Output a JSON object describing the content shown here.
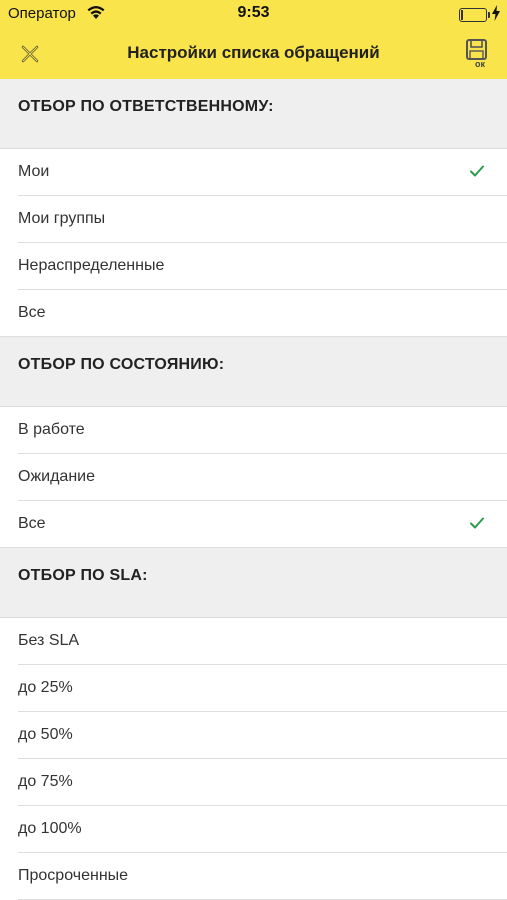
{
  "status_bar": {
    "carrier": "Оператор",
    "time": "9:53"
  },
  "nav": {
    "title": "Настройки списка обращений",
    "close_icon": "close-icon",
    "ok_icon": "save-ok-icon"
  },
  "sections": [
    {
      "header": "ОТБОР ПО ОТВЕТСТВЕННОМУ:",
      "items": [
        {
          "label": "Мои",
          "selected": true
        },
        {
          "label": "Мои группы",
          "selected": false
        },
        {
          "label": "Нераспределенные",
          "selected": false
        },
        {
          "label": "Все",
          "selected": false
        }
      ]
    },
    {
      "header": "ОТБОР ПО СОСТОЯНИЮ:",
      "items": [
        {
          "label": "В работе",
          "selected": false
        },
        {
          "label": "Ожидание",
          "selected": false
        },
        {
          "label": "Все",
          "selected": true
        }
      ]
    },
    {
      "header": "ОТБОР ПО SLA:",
      "items": [
        {
          "label": "Без SLA",
          "selected": false
        },
        {
          "label": "до 25%",
          "selected": false
        },
        {
          "label": "до 50%",
          "selected": false
        },
        {
          "label": "до 75%",
          "selected": false
        },
        {
          "label": "до 100%",
          "selected": false
        },
        {
          "label": "Просроченные",
          "selected": false
        }
      ]
    }
  ],
  "colors": {
    "accent": "#f9e44c",
    "check": "#2e9b4a",
    "section_bg": "#efeff0"
  }
}
